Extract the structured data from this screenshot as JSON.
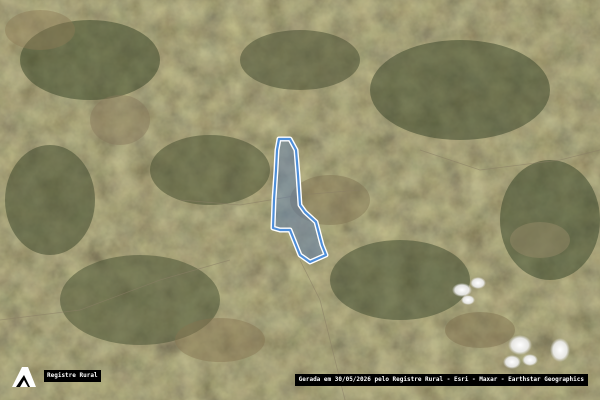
{
  "map": {
    "basemap": "satellite-imagery",
    "land_color": "#5a5238",
    "boundary_color": "#4f8fd9",
    "boundary_fill": "#5b7fb8",
    "boundary_outline": "#ffffff"
  },
  "brand": {
    "logo_icon": "registre-rural-logo-icon",
    "name": "Registre Rural"
  },
  "attribution": {
    "text": "Gerada em 30/05/2026 pelo Registre Rural - Esri - Maxar - Earthstar Geographics"
  }
}
